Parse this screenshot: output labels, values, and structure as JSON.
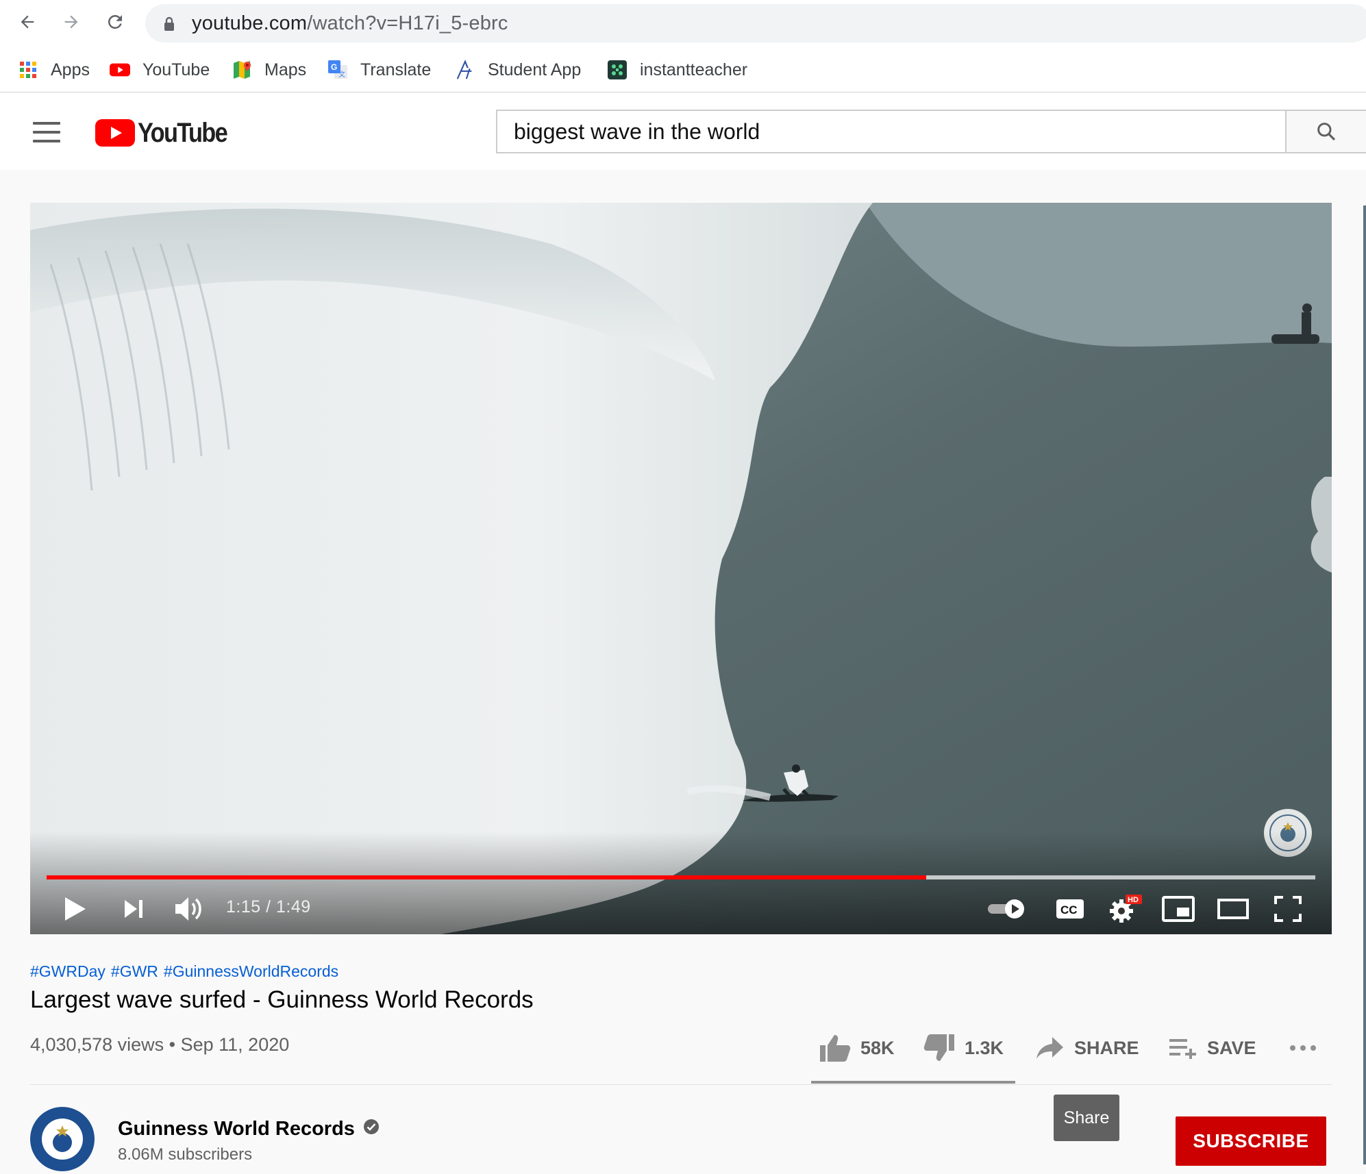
{
  "browser": {
    "url_host": "youtube.com",
    "url_path": "/watch?v=H17i_5-ebrc",
    "bookmarks": [
      {
        "label": "Apps",
        "icon": "apps-grid-icon"
      },
      {
        "label": "YouTube",
        "icon": "youtube-icon"
      },
      {
        "label": "Maps",
        "icon": "maps-icon"
      },
      {
        "label": "Translate",
        "icon": "translate-icon"
      },
      {
        "label": "Student App",
        "icon": "student-app-icon"
      },
      {
        "label": "instantteacher",
        "icon": "instantteacher-icon"
      }
    ]
  },
  "youtube": {
    "logo_text": "YouTube",
    "search_query": "biggest wave in the world"
  },
  "player": {
    "current_time": "1:15",
    "duration": "1:49",
    "time_display": "1:15 / 1:49",
    "played_fraction": 0.6932,
    "buffered_fraction": 1.0,
    "hd_badge": "HD",
    "cc_label": "CC"
  },
  "video": {
    "hashtags": [
      "#GWRDay",
      "#GWR",
      "#GuinnessWorldRecords"
    ],
    "title": "Largest wave surfed - Guinness World Records",
    "views": "4,030,578 views",
    "date": "Sep 11, 2020",
    "likes": "58K",
    "dislikes": "1.3K",
    "share_label": "SHARE",
    "save_label": "SAVE"
  },
  "channel": {
    "name": "Guinness World Records",
    "subscribers": "8.06M subscribers",
    "subscribe_label": "SUBSCRIBE",
    "tooltip": "Share"
  },
  "colors": {
    "brand_red": "#ff0000",
    "subscribe_red": "#cc0000",
    "link_blue": "#065fd4"
  }
}
